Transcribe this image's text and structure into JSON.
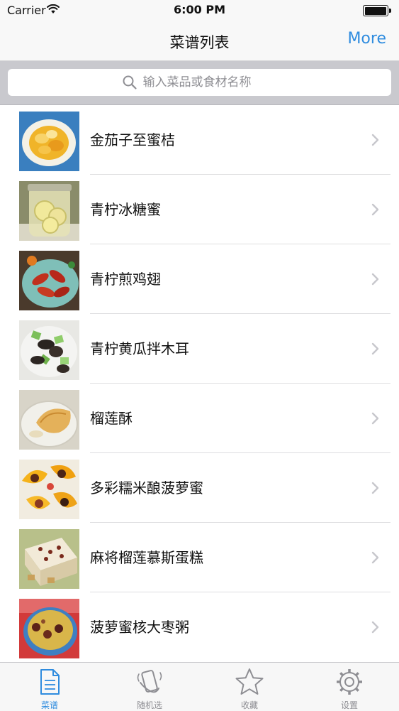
{
  "status_bar": {
    "carrier": "Carrier",
    "time": "6:00 PM"
  },
  "nav": {
    "title": "菜谱列表",
    "more": "More"
  },
  "search": {
    "placeholder": "输入菜品或食材名称"
  },
  "recipes": [
    {
      "name": "金茄子至蜜桔",
      "thumb": "orange-slices-bowl"
    },
    {
      "name": "青柠冰糖蜜",
      "thumb": "lime-honey-jar"
    },
    {
      "name": "青柠煎鸡翅",
      "thumb": "chicken-wings-plate"
    },
    {
      "name": "青柠黄瓜拌木耳",
      "thumb": "cucumber-fungus-salad"
    },
    {
      "name": "榴莲酥",
      "thumb": "durian-pastry"
    },
    {
      "name": "多彩糯米酿菠萝蜜",
      "thumb": "jackfruit-sticky-rice"
    },
    {
      "name": "麻将榴莲慕斯蛋糕",
      "thumb": "mousse-cake"
    },
    {
      "name": "菠萝蜜核大枣粥",
      "thumb": "jujube-porridge"
    }
  ],
  "tabs": [
    {
      "label": "菜谱",
      "icon": "document-icon",
      "active": true
    },
    {
      "label": "随机选",
      "icon": "shake-phone-icon",
      "active": false
    },
    {
      "label": "收藏",
      "icon": "star-icon",
      "active": false
    },
    {
      "label": "设置",
      "icon": "gear-icon",
      "active": false
    }
  ],
  "colors": {
    "accent": "#2f8cdf",
    "inactive": "#8e8e93",
    "search_bar_bg": "#c9c9ce"
  }
}
